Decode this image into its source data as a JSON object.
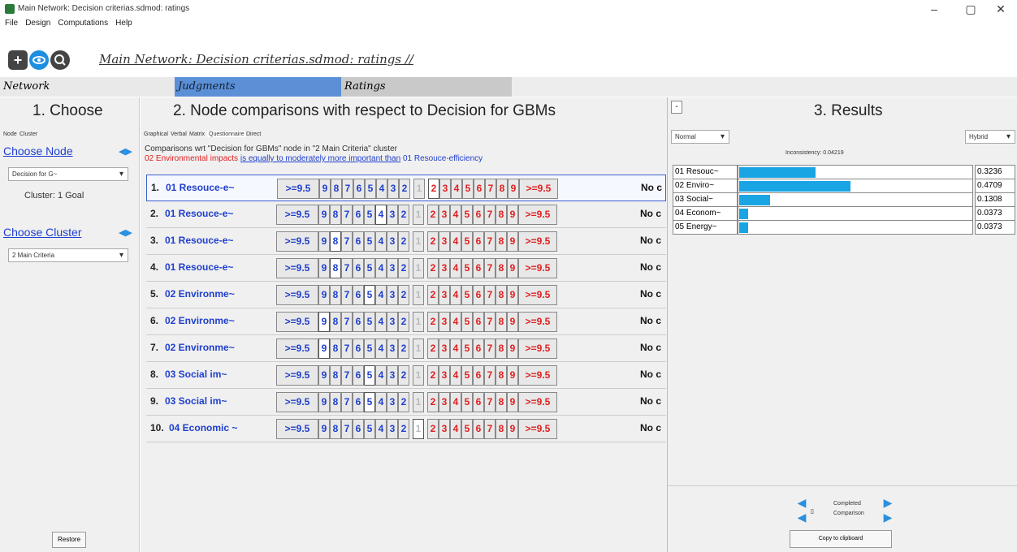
{
  "window": {
    "title": "Main Network: Decision criterias.sdmod: ratings",
    "minimize": "–",
    "restore": "▢",
    "close": "✕"
  },
  "menu": [
    "File",
    "Design",
    "Computations",
    "Help"
  ],
  "toolbar": {
    "path": "Main Network: Decision criterias.sdmod: ratings //",
    "icons": [
      "plus-icon",
      "eye-icon",
      "search-icon"
    ]
  },
  "tabs": {
    "network": "Network",
    "judgments": "Judgments",
    "ratings": "Ratings"
  },
  "left": {
    "header": "1. Choose",
    "subtabs": [
      "Node",
      "Cluster"
    ],
    "choose_node_label": "Choose Node",
    "node_value": "Decision for G~",
    "cluster_caption": "Cluster: 1 Goal",
    "choose_cluster_label": "Choose Cluster",
    "cluster_value": "2 Main Criteria",
    "restore_button": "Restore"
  },
  "middle": {
    "header": "2. Node comparisons with respect to Decision for GBMs",
    "subtabs": [
      "Graphical",
      "Verbal",
      "Matrix",
      "Questionnaire",
      "Direct"
    ],
    "info_line": "Comparisons wrt \"Decision for GBMs\" node in \"2 Main Criteria\" cluster",
    "verbal_a": "02 Environmental impacts",
    "verbal_b": "is equally to moderately more important than",
    "verbal_c": "01 Resouce-efficiency",
    "scale_left": [
      ">=9.5",
      "9",
      "8",
      "7",
      "6",
      "5",
      "4",
      "3",
      "2"
    ],
    "scale_mid": "1",
    "scale_right": [
      "2",
      "3",
      "4",
      "5",
      "6",
      "7",
      "8",
      "9",
      ">=9.5"
    ],
    "noc": "No c",
    "rows": [
      {
        "num": "1.",
        "label": "01 Resouce-e~",
        "sel": "r2"
      },
      {
        "num": "2.",
        "label": "01 Resouce-e~",
        "sel": "l4"
      },
      {
        "num": "3.",
        "label": "01 Resouce-e~",
        "sel": "l8"
      },
      {
        "num": "4.",
        "label": "01 Resouce-e~",
        "sel": "l8"
      },
      {
        "num": "5.",
        "label": "02 Environme~",
        "sel": "l5"
      },
      {
        "num": "6.",
        "label": "02 Environme~",
        "sel": "l9"
      },
      {
        "num": "7.",
        "label": "02 Environme~",
        "sel": "l9"
      },
      {
        "num": "8.",
        "label": "03 Social im~",
        "sel": "l5"
      },
      {
        "num": "9.",
        "label": "03 Social im~",
        "sel": "l5"
      },
      {
        "num": "10.",
        "label": "04 Economic ~",
        "sel": "m1"
      }
    ]
  },
  "right": {
    "collapse_button": "-",
    "header": "3. Results",
    "mode_left": "Normal",
    "mode_right": "Hybrid",
    "inconsistency": "Inconsistency: 0.04219",
    "results": [
      {
        "label": "01 Resouc~",
        "value": "0.3236",
        "fraction": 0.3236
      },
      {
        "label": "02 Enviro~",
        "value": "0.4709",
        "fraction": 0.4709
      },
      {
        "label": "03 Social~",
        "value": "0.1308",
        "fraction": 0.1308
      },
      {
        "label": "04 Econom~",
        "value": "0.0373",
        "fraction": 0.0373
      },
      {
        "label": "05 Energy~",
        "value": "0.0373",
        "fraction": 0.0373
      }
    ],
    "completed": "Completed",
    "comparison": "Comparison",
    "copy_button": "Copy to clipboard"
  },
  "colors": {
    "bar": "#19a4e4",
    "blue_text": "#1f3fcc",
    "red_text": "#e02020",
    "tab_active": "#5b8fd6"
  }
}
